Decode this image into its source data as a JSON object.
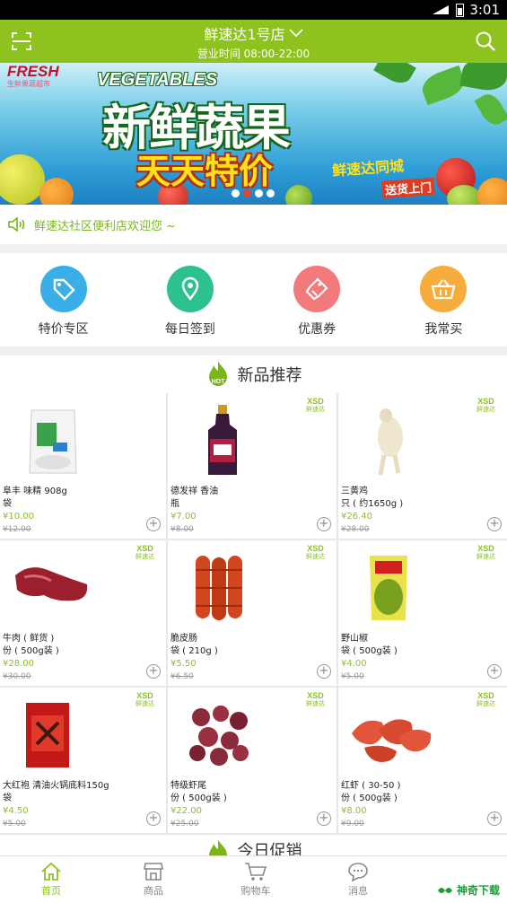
{
  "status_bar": {
    "time": "3:01"
  },
  "header": {
    "store_name": "鲜速达1号店",
    "hours": "营业时间 08:00-22:00"
  },
  "banner": {
    "fresh": "FRESH",
    "fresh_sub": "生鲜果蔬超市",
    "vegetables": "VEGETABLES",
    "headline": "新鲜蔬果",
    "subline": "天天特价",
    "brand": "鲜速达同城",
    "delivery": "送货上门"
  },
  "notice": {
    "text": "鲜速达社区便利店欢迎您 ~"
  },
  "quick_menu": [
    {
      "label": "特价专区",
      "color": "#3aaee6",
      "icon": "tag-icon"
    },
    {
      "label": "每日签到",
      "color": "#2dc28d",
      "icon": "location-pin-icon"
    },
    {
      "label": "优惠券",
      "color": "#f27a7a",
      "icon": "coupon-icon"
    },
    {
      "label": "我常买",
      "color": "#f7ad3b",
      "icon": "basket-icon"
    }
  ],
  "new_products": {
    "title": "新品推荐",
    "badge": "HOT",
    "logo": "XSD",
    "logo_sub": "鲜速达",
    "items": [
      {
        "name": "阜丰 味精 908g",
        "unit": "袋",
        "price": "¥10.00",
        "old_price": "¥12.00"
      },
      {
        "name": "德发祥 香油",
        "unit": "瓶",
        "price": "¥7.00",
        "old_price": "¥8.00"
      },
      {
        "name": "三黄鸡",
        "unit": "只 ( 约1650g )",
        "price": "¥26.40",
        "old_price": "¥28.00"
      },
      {
        "name": "牛肉 ( 鲜货 )",
        "unit": "份 ( 500g装 )",
        "price": "¥28.00",
        "old_price": "¥30.00"
      },
      {
        "name": "脆皮肠",
        "unit": "袋 ( 210g )",
        "price": "¥5.50",
        "old_price": "¥6.50"
      },
      {
        "name": "野山椒",
        "unit": "袋 ( 500g装 )",
        "price": "¥4.00",
        "old_price": "¥5.00"
      },
      {
        "name": "大红袍 清油火锅底料150g",
        "unit": "袋",
        "price": "¥4.50",
        "old_price": "¥5.00"
      },
      {
        "name": "特级虾尾",
        "unit": "份 ( 500g装 )",
        "price": "¥22.00",
        "old_price": "¥25.00"
      },
      {
        "name": "红虾 ( 30-50 )",
        "unit": "份 ( 500g装 )",
        "price": "¥8.00",
        "old_price": "¥9.00"
      }
    ]
  },
  "next_section": {
    "title": "今日促销"
  },
  "tabs": [
    {
      "label": "首页",
      "icon": "home-icon",
      "active": true
    },
    {
      "label": "商品",
      "icon": "store-icon"
    },
    {
      "label": "购物车",
      "icon": "cart-icon"
    },
    {
      "label": "消息",
      "icon": "message-icon"
    }
  ],
  "watermark": {
    "text": "神奇下载"
  },
  "colors": {
    "primary": "#8dc21f",
    "price": "#8dc21f"
  }
}
